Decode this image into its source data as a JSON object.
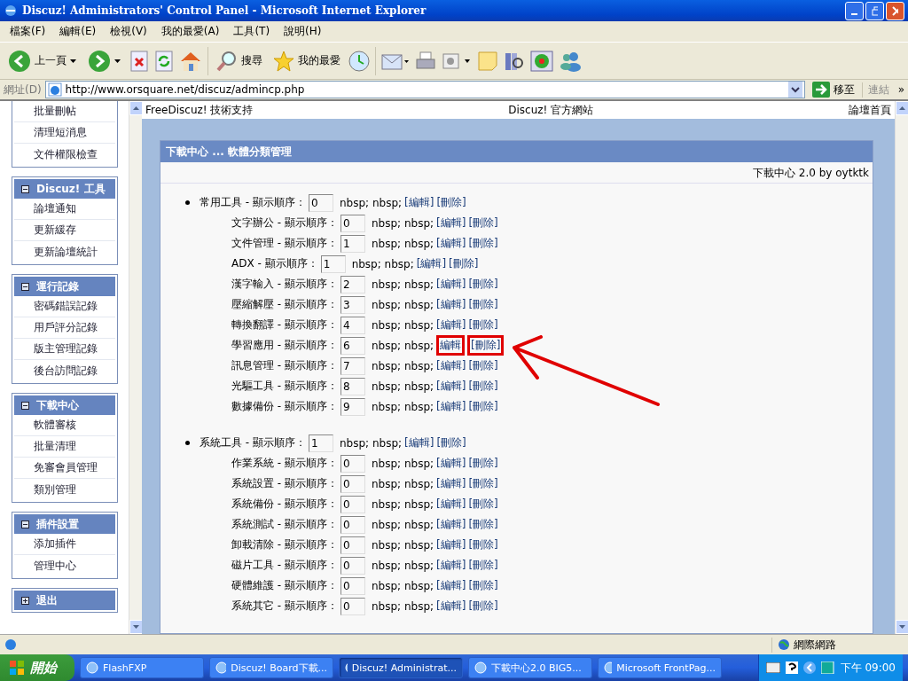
{
  "window": {
    "title": "Discuz! Administrators' Control Panel - Microsoft Internet Explorer"
  },
  "menu": [
    "檔案(F)",
    "編輯(E)",
    "檢視(V)",
    "我的最愛(A)",
    "工具(T)",
    "說明(H)"
  ],
  "toolbar": {
    "back": "上一頁",
    "search": "搜尋",
    "favorites": "我的最愛"
  },
  "address": {
    "label": "網址(D)",
    "value": "http://www.orsquare.net/discuz/admincp.php",
    "go": "移至",
    "links": "連結",
    "more": "»"
  },
  "sidebar": {
    "groups": [
      {
        "items": [
          "批量刪帖",
          "清理短消息",
          "文件權限檢查"
        ]
      },
      {
        "title": "Discuz! 工具",
        "expanded": true,
        "items": [
          "論壇通知",
          "更新緩存",
          "更新論壇統計"
        ]
      },
      {
        "title": "運行記錄",
        "expanded": true,
        "items": [
          "密碼錯誤記錄",
          "用戶評分記錄",
          "版主管理記錄",
          "後台訪問記錄"
        ]
      },
      {
        "title": "下載中心",
        "expanded": true,
        "items": [
          "軟體審核",
          "批量清理",
          "免審會員管理",
          "類別管理"
        ]
      },
      {
        "title": "插件設置",
        "expanded": true,
        "items": [
          "添加插件",
          "管理中心"
        ]
      },
      {
        "title": "退出",
        "expanded": false
      }
    ]
  },
  "top_links": [
    "FreeDiscuz! 技術支持",
    "Discuz! 官方網站",
    "論壇首頁"
  ],
  "panel": {
    "title": "下載中心 ... 軟體分類管理",
    "subtitle": "下載中心 2.0 by oytktk",
    "categories": [
      {
        "label": "常用工具 - 顯示順序：",
        "order": "0",
        "note": "nbsp; nbsp;",
        "edit": "[編輯]",
        "delete": "[刪除]",
        "highlighted": false,
        "children": [
          {
            "label": "文字辦公 - 顯示順序：",
            "order": "0",
            "note": "nbsp; nbsp;",
            "edit": "[編輯]",
            "delete": "[刪除]",
            "highlighted": false
          },
          {
            "label": "文件管理 - 顯示順序：",
            "order": "1",
            "note": "nbsp; nbsp;",
            "edit": "[編輯]",
            "delete": "[刪除]",
            "highlighted": false
          },
          {
            "label": "ADX - 顯示順序：",
            "order": "1",
            "note": "nbsp; nbsp;",
            "edit": "[編輯]",
            "delete": "[刪除]",
            "highlighted": false
          },
          {
            "label": "漢字輸入 - 顯示順序：",
            "order": "2",
            "note": "nbsp; nbsp;",
            "edit": "[編輯]",
            "delete": "[刪除]",
            "highlighted": false
          },
          {
            "label": "壓縮解壓 - 顯示順序：",
            "order": "3",
            "note": "nbsp; nbsp;",
            "edit": "[編輯]",
            "delete": "[刪除]",
            "highlighted": false
          },
          {
            "label": "轉換翻譯 - 顯示順序：",
            "order": "4",
            "note": "nbsp; nbsp;",
            "edit": "[編輯]",
            "delete": "[刪除]",
            "highlighted": false
          },
          {
            "label": "學習應用 - 顯示順序：",
            "order": "6",
            "note": "nbsp; nbsp;",
            "edit": "編輯",
            "delete": "[刪除]",
            "highlighted": true
          },
          {
            "label": "訊息管理 - 顯示順序：",
            "order": "7",
            "note": "nbsp; nbsp;",
            "edit": "[編輯]",
            "delete": "[刪除]",
            "highlighted": false
          },
          {
            "label": "光驅工具 - 顯示順序：",
            "order": "8",
            "note": "nbsp; nbsp;",
            "edit": "[編輯]",
            "delete": "[刪除]",
            "highlighted": false
          },
          {
            "label": "數據備份 - 顯示順序：",
            "order": "9",
            "note": "nbsp; nbsp;",
            "edit": "[編輯]",
            "delete": "[刪除]",
            "highlighted": false
          }
        ]
      },
      {
        "label": "系統工具 - 顯示順序：",
        "order": "1",
        "note": "nbsp; nbsp;",
        "edit": "[編輯]",
        "delete": "[刪除]",
        "highlighted": false,
        "children": [
          {
            "label": "作業系統 - 顯示順序：",
            "order": "0",
            "note": "nbsp; nbsp;",
            "edit": "[編輯]",
            "delete": "[刪除]",
            "highlighted": false
          },
          {
            "label": "系統設置 - 顯示順序：",
            "order": "0",
            "note": "nbsp; nbsp;",
            "edit": "[編輯]",
            "delete": "[刪除]",
            "highlighted": false
          },
          {
            "label": "系統備份 - 顯示順序：",
            "order": "0",
            "note": "nbsp; nbsp;",
            "edit": "[編輯]",
            "delete": "[刪除]",
            "highlighted": false
          },
          {
            "label": "系統測試 - 顯示順序：",
            "order": "0",
            "note": "nbsp; nbsp;",
            "edit": "[編輯]",
            "delete": "[刪除]",
            "highlighted": false
          },
          {
            "label": "卸載清除 - 顯示順序：",
            "order": "0",
            "note": "nbsp; nbsp;",
            "edit": "[編輯]",
            "delete": "[刪除]",
            "highlighted": false
          },
          {
            "label": "磁片工具 - 顯示順序：",
            "order": "0",
            "note": "nbsp; nbsp;",
            "edit": "[編輯]",
            "delete": "[刪除]",
            "highlighted": false
          },
          {
            "label": "硬體維護 - 顯示順序：",
            "order": "0",
            "note": "nbsp; nbsp;",
            "edit": "[編輯]",
            "delete": "[刪除]",
            "highlighted": false
          },
          {
            "label": "系統其它 - 顯示順序：",
            "order": "0",
            "note": "nbsp; nbsp;",
            "edit": "[編輯]",
            "delete": "[刪除]",
            "highlighted": false
          }
        ]
      }
    ]
  },
  "status_bar": {
    "zone": "網際網路"
  },
  "taskbar": {
    "start": "開始",
    "tasks": [
      {
        "label": "FlashFXP",
        "selected": false
      },
      {
        "label": "Discuz! Board下載...",
        "selected": false
      },
      {
        "label": "Discuz! Administrat...",
        "selected": true
      },
      {
        "label": "下載中心2.0 BIG5...",
        "selected": false
      },
      {
        "label": "Microsoft FrontPag...",
        "selected": false
      }
    ],
    "clock": "下午 09:00"
  }
}
